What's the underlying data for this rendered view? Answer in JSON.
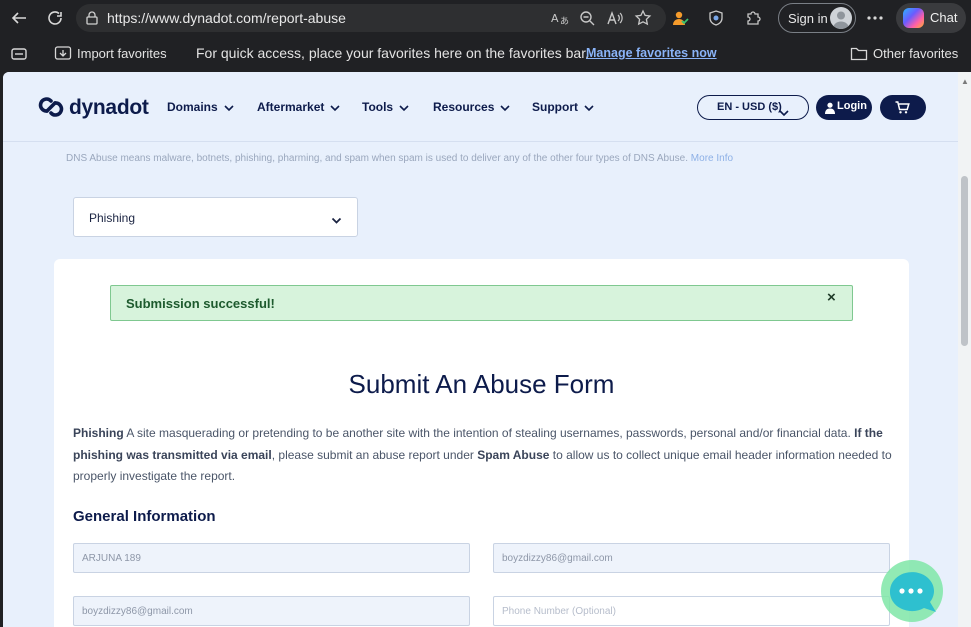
{
  "browser": {
    "url": "https://www.dynadot.com/report-abuse",
    "sign_in_label": "Sign in",
    "chat_label": "Chat",
    "favorites": {
      "import_label": "Import favorites",
      "hint": "For quick access, place your favorites here on the favorites bar.",
      "manage_link": "Manage favorites now",
      "other_label": "Other favorites"
    }
  },
  "site": {
    "brand": "dynadot",
    "nav": [
      "Domains",
      "Aftermarket",
      "Tools",
      "Resources",
      "Support"
    ],
    "language_currency": "EN - USD ($)",
    "login_label": "Login"
  },
  "main": {
    "dns_note": "DNS Abuse means malware, botnets, phishing, pharming, and spam when spam is used to deliver any of the other four types of DNS Abuse.",
    "more_info": "More Info",
    "abuse_type": "Phishing",
    "alert": "Submission successful!",
    "alert_close": "×",
    "form_title": "Submit An Abuse Form",
    "desc_term": "Phishing",
    "desc_1": " A site masquerading or pretending to be another site with the intention of stealing usernames, passwords, personal and/or financial data. ",
    "desc_bold_2": "If the phishing was transmitted via email",
    "desc_2": ", please submit an abuse report under ",
    "desc_bold_3": "Spam Abuse",
    "desc_3": " to allow us to collect unique email header information needed to properly investigate the report.",
    "section_title": "General Information",
    "fields": {
      "name": "ARJUNA 189",
      "email": "boyzdizzy86@gmail.com",
      "confirm_email": "boyzdizzy86@gmail.com",
      "phone_placeholder": "Phone Number (Optional)"
    }
  }
}
